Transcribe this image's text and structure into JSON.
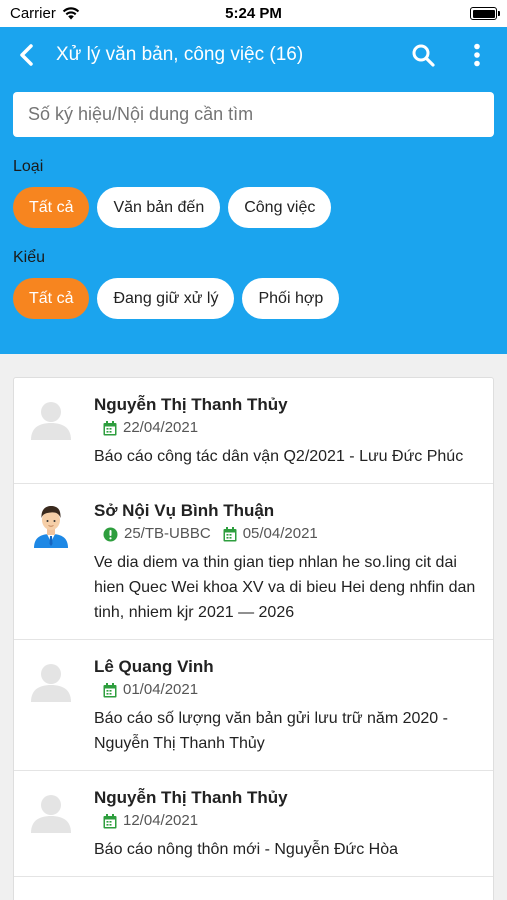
{
  "status_bar": {
    "carrier": "Carrier",
    "time": "5:24 PM"
  },
  "header": {
    "title": "Xử lý văn bản, công việc (16)"
  },
  "search": {
    "placeholder": "Số ký hiệu/Nội dung cần tìm"
  },
  "filters": {
    "type_label": "Loại",
    "type_chips": [
      "Tất cả",
      "Văn bản đến",
      "Công việc"
    ],
    "kind_label": "Kiểu",
    "kind_chips": [
      "Tất cả",
      "Đang giữ xử lý",
      "Phối hợp"
    ]
  },
  "colors": {
    "header": "#1ba4ee",
    "accent": "#f7851f",
    "calendar": "#2e9e3e",
    "alert": "#2e9e3e"
  },
  "items": [
    {
      "name": "Nguyễn Thị Thanh Thủy",
      "date": "22/04/2021",
      "description": "Báo cáo công tác dân vận Q2/2021 - Lưu Đức Phúc",
      "avatar": "placeholder"
    },
    {
      "name": "Sở Nội Vụ Bình Thuận",
      "code": "25/TB-UBBC",
      "date": "05/04/2021",
      "description": "Ve dia diem va thin gian tiep nhlan he so.ling cit dai hien Quec Wei khoa XV va di bieu Hei deng nhfin dan tinh, nhiem kjr 2021 — 2026",
      "avatar": "person"
    },
    {
      "name": "Lê Quang Vinh",
      "date": "01/04/2021",
      "description": "Báo cáo số lượng văn bản gửi lưu trữ năm 2020 - Nguyễn Thị Thanh Thủy",
      "avatar": "placeholder"
    },
    {
      "name": "Nguyễn Thị Thanh Thủy",
      "date": "12/04/2021",
      "description": "Báo cáo nông thôn mới - Nguyễn Đức Hòa",
      "avatar": "placeholder"
    }
  ]
}
